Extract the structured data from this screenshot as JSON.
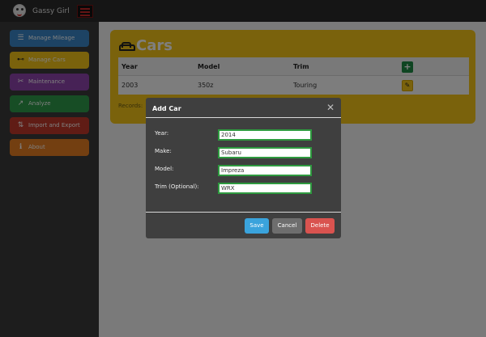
{
  "header": {
    "app_title": "Gassy Girl"
  },
  "sidebar": {
    "items": [
      {
        "label": "Manage Mileage",
        "icon": "list-icon",
        "color": "#3a87c8"
      },
      {
        "label": "Manage Cars",
        "icon": "car-icon",
        "color": "#f5c518"
      },
      {
        "label": "Maintenance",
        "icon": "wrench-icon",
        "color": "#8e44ad"
      },
      {
        "label": "Analyze",
        "icon": "chart-icon",
        "color": "#2e9a4a"
      },
      {
        "label": "Import and Export",
        "icon": "import-export-icon",
        "color": "#c0392b"
      },
      {
        "label": "About",
        "icon": "info-icon",
        "color": "#e67e22"
      }
    ]
  },
  "main": {
    "panel_title": "Cars",
    "table": {
      "columns": [
        "Year",
        "Model",
        "Trim"
      ],
      "rows": [
        {
          "year": "2003",
          "model": "350z",
          "trim": "Touring"
        }
      ]
    },
    "records_label": "Records:"
  },
  "modal": {
    "title": "Add Car",
    "fields": [
      {
        "label": "Year:",
        "value": "2014"
      },
      {
        "label": "Make:",
        "value": "Subaru"
      },
      {
        "label": "Model:",
        "value": "Impreza"
      },
      {
        "label": "Trim (Optional):",
        "value": "WRX"
      }
    ],
    "buttons": {
      "save": "Save",
      "cancel": "Cancel",
      "delete": "Delete"
    }
  },
  "colors": {
    "panel": "#f5c518",
    "save": "#3aa3dc",
    "cancel": "#6e6e6e",
    "delete": "#d9534f",
    "input_border": "#2e9a3f"
  }
}
